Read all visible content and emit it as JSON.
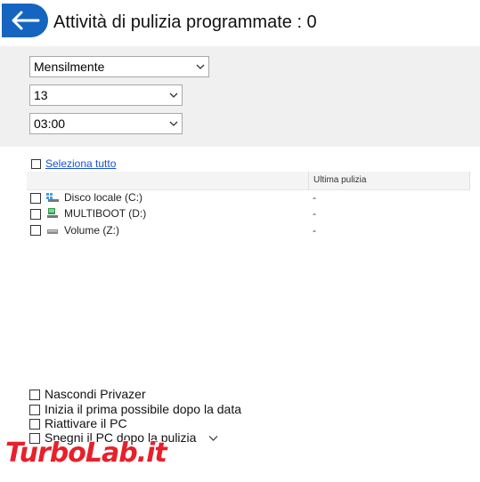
{
  "header": {
    "title": "Attività di pulizia programmate : 0",
    "back_icon": "arrow-left-icon"
  },
  "schedule": {
    "frequency": "Mensilmente",
    "day": "13",
    "time": "03:00"
  },
  "select_all_label": "Seleziona tutto",
  "table": {
    "column_last_cleaning": "Ultima pulizia",
    "rows": [
      {
        "label": "Disco locale (C:)",
        "last": "-",
        "icon": "system-drive-icon",
        "checked": false
      },
      {
        "label": "MULTIBOOT (D:)",
        "last": "-",
        "icon": "usb-drive-icon",
        "checked": false
      },
      {
        "label": "Volume (Z:)",
        "last": "-",
        "icon": "drive-icon",
        "checked": false
      }
    ]
  },
  "options": [
    {
      "label": "Nascondi Privazer",
      "checked": false
    },
    {
      "label": "Inizia il prima possibile dopo la data",
      "checked": false
    },
    {
      "label": "Riattivare il PC",
      "checked": false
    },
    {
      "label": "Spegni il PC dopo la pulizia",
      "checked": false
    }
  ],
  "watermark": "TurboLab.it",
  "colors": {
    "accent": "#1565c0",
    "link": "#1a4fd6",
    "panel": "#f0f0f0",
    "watermark": "#e8202a"
  }
}
